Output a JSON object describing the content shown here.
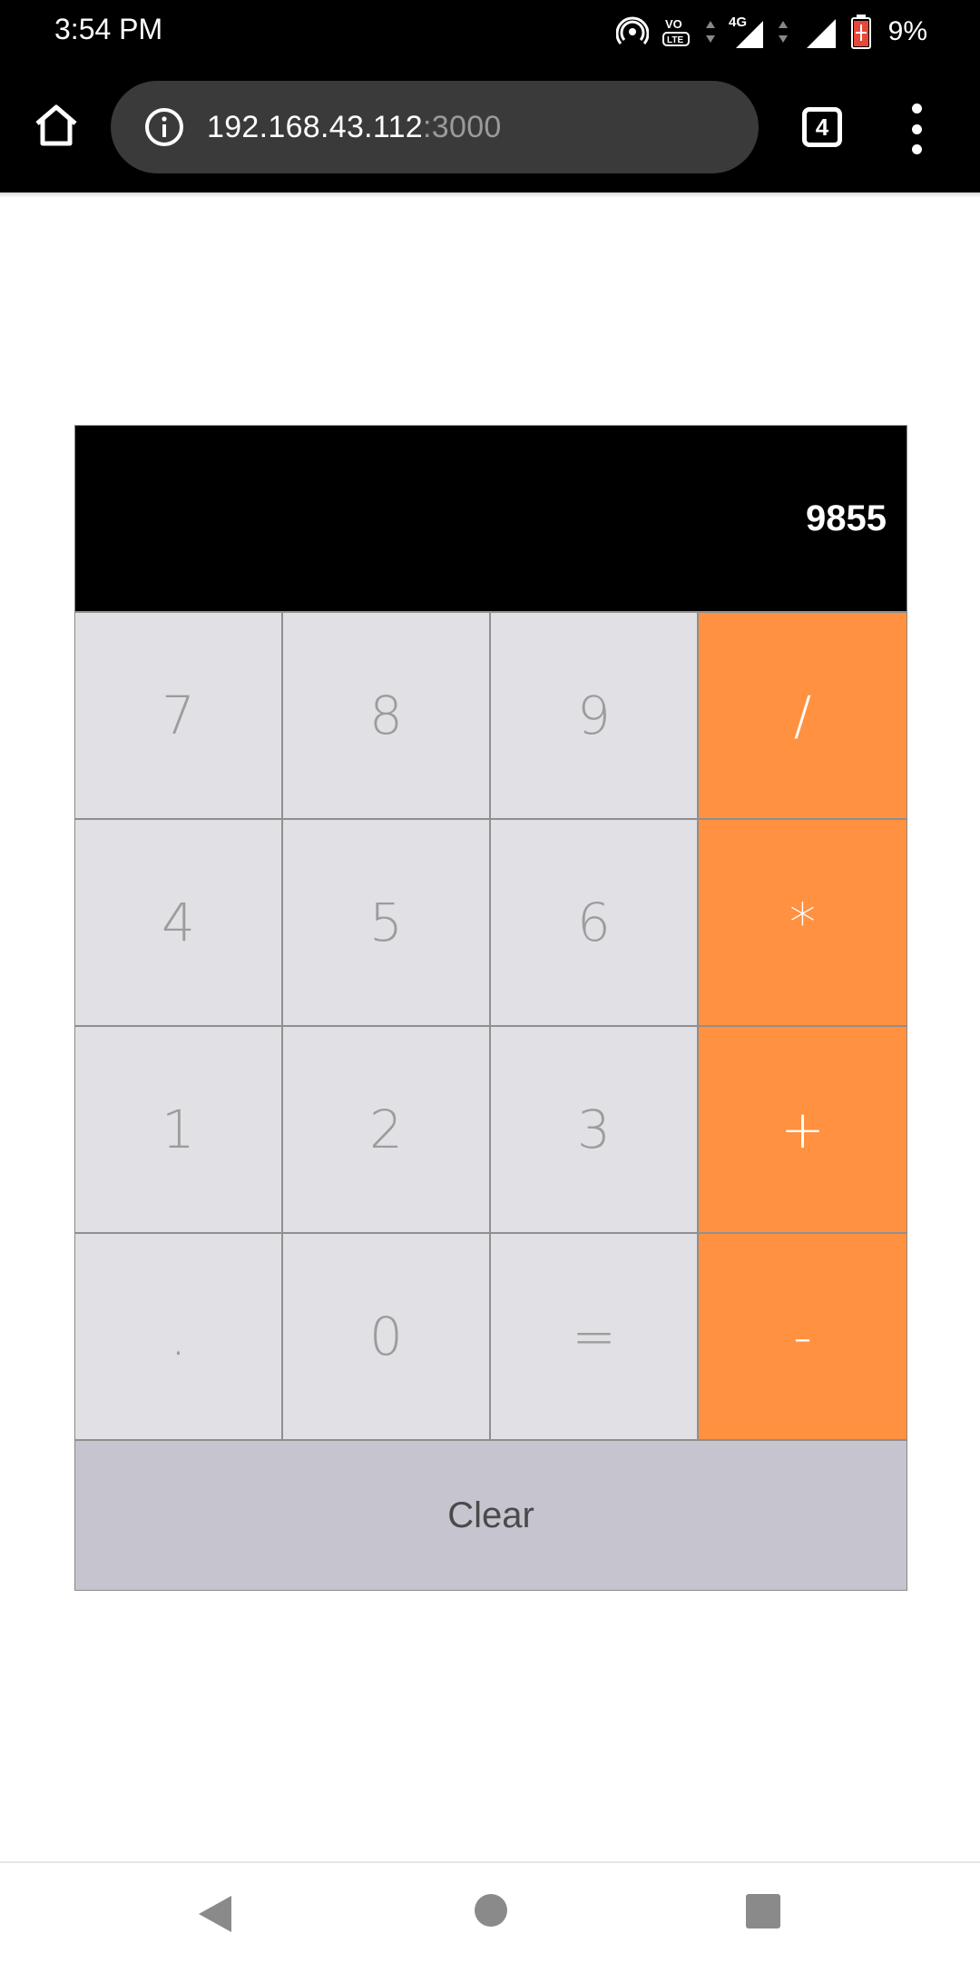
{
  "status_bar": {
    "time": "3:54 PM",
    "network_label": "4G",
    "volte_label": "Vo LTE",
    "battery_percent": "9%"
  },
  "browser": {
    "url_host": "192.168.43.112",
    "url_port": ":3000",
    "tab_count": "4"
  },
  "calculator": {
    "display": "9855",
    "keys": [
      {
        "label": "7",
        "type": "digit"
      },
      {
        "label": "8",
        "type": "digit"
      },
      {
        "label": "9",
        "type": "digit"
      },
      {
        "label": "/",
        "type": "operator"
      },
      {
        "label": "4",
        "type": "digit"
      },
      {
        "label": "5",
        "type": "digit"
      },
      {
        "label": "6",
        "type": "digit"
      },
      {
        "label": "*",
        "type": "operator"
      },
      {
        "label": "1",
        "type": "digit"
      },
      {
        "label": "2",
        "type": "digit"
      },
      {
        "label": "3",
        "type": "digit"
      },
      {
        "label": "+",
        "type": "operator"
      },
      {
        "label": ".",
        "type": "digit"
      },
      {
        "label": "0",
        "type": "digit"
      },
      {
        "label": "=",
        "type": "digit"
      },
      {
        "label": "-",
        "type": "operator"
      }
    ],
    "clear_label": "Clear"
  },
  "colors": {
    "operator_key": "#ff9140",
    "digit_key": "#e1e1e5",
    "clear_key": "#c6c4ce",
    "display_bg": "#000000"
  },
  "icons": {
    "home": "home-icon",
    "info": "info-icon",
    "tabs": "tabs-icon",
    "menu": "more-vert-icon"
  }
}
